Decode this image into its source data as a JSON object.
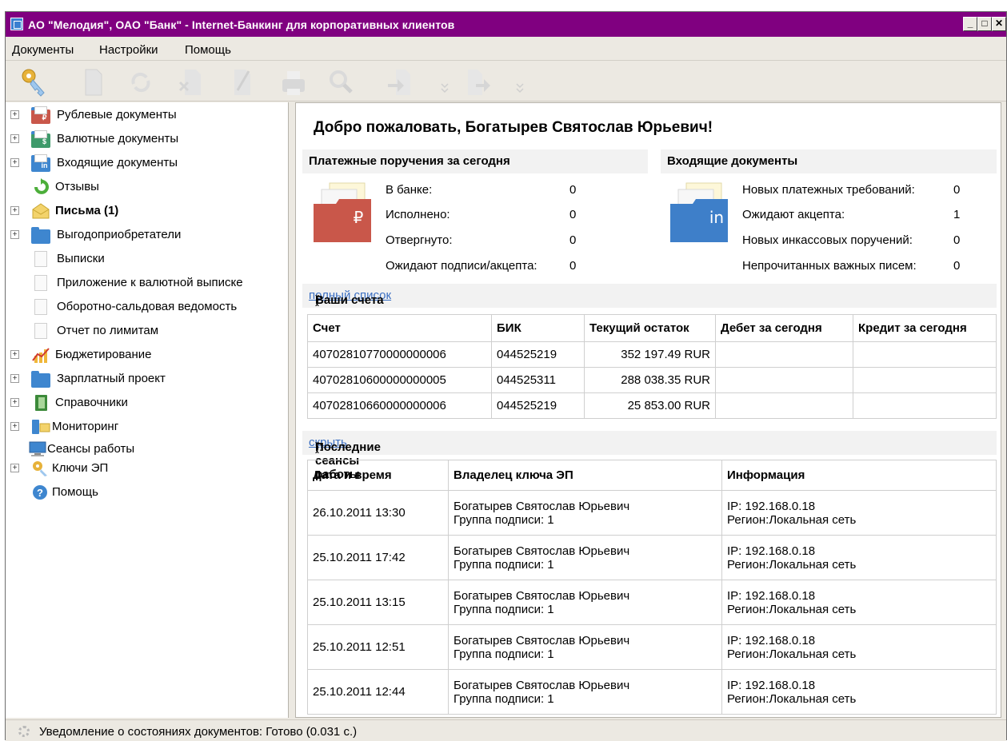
{
  "window": {
    "title": "АО \"Мелодия\", ОАО \"Банк\" - Internet-Банкинг для корпоративных клиентов"
  },
  "menu": [
    "Документы",
    "Настройки",
    "Помощь"
  ],
  "sidebar": {
    "items": [
      {
        "label": "Рублевые документы",
        "icon": "ruble-folder-icon",
        "expandable": true,
        "bold": false
      },
      {
        "label": "Валютные документы",
        "icon": "currency-folder-icon",
        "expandable": true,
        "bold": false
      },
      {
        "label": "Входящие документы",
        "icon": "incoming-folder-icon",
        "expandable": true,
        "bold": false
      },
      {
        "label": "Отзывы",
        "icon": "revoke-icon",
        "expandable": false,
        "bold": false
      },
      {
        "label": "Письма (1)",
        "icon": "envelope-icon",
        "expandable": true,
        "bold": true
      },
      {
        "label": "Выгодоприобретатели",
        "icon": "folder-icon",
        "expandable": true,
        "bold": false
      },
      {
        "label": "Выписки",
        "icon": "document-icon",
        "expandable": false,
        "bold": false
      },
      {
        "label": "Приложение к валютной выписке",
        "icon": "document-icon",
        "expandable": false,
        "bold": false
      },
      {
        "label": "Оборотно-сальдовая ведомость",
        "icon": "document-icon",
        "expandable": false,
        "bold": false
      },
      {
        "label": "Отчет по лимитам",
        "icon": "document-icon",
        "expandable": false,
        "bold": false
      },
      {
        "label": "Бюджетирование",
        "icon": "chart-icon",
        "expandable": true,
        "bold": false
      },
      {
        "label": "Зарплатный проект",
        "icon": "folder-icon",
        "expandable": true,
        "bold": false
      },
      {
        "label": "Справочники",
        "icon": "book-icon",
        "expandable": true,
        "bold": false
      },
      {
        "label": "Мониторинг",
        "icon": "monitoring-icon",
        "expandable": true,
        "bold": false
      },
      {
        "label": "Сеансы работы",
        "icon": "computer-icon",
        "expandable": false,
        "bold": false
      },
      {
        "label": "Ключи ЭП",
        "icon": "key-icon",
        "expandable": true,
        "bold": false
      },
      {
        "label": "Помощь",
        "icon": "help-icon",
        "expandable": false,
        "bold": false
      }
    ]
  },
  "main": {
    "welcome": "Добро пожаловать, Богатырев Святослав Юрьевич!",
    "payments": {
      "title": "Платежные поручения за сегодня",
      "rows": [
        {
          "label": "В банке:",
          "value": "0"
        },
        {
          "label": "Исполнено:",
          "value": "0"
        },
        {
          "label": "Отвергнуто:",
          "value": "0"
        },
        {
          "label": "Ожидают подписи/акцепта:",
          "value": "0"
        }
      ],
      "badge": "₽"
    },
    "incoming": {
      "title": "Входящие документы",
      "rows": [
        {
          "label": "Новых платежных требований:",
          "value": "0"
        },
        {
          "label": "Ожидают акцепта:",
          "value": "1"
        },
        {
          "label": "Новых инкассовых поручений:",
          "value": "0"
        },
        {
          "label": "Непрочитанных важных писем:",
          "value": "0"
        }
      ],
      "badge": "in"
    },
    "accounts": {
      "title": "Ваши счета",
      "link": "полный список",
      "tail": "):",
      "open": " (",
      "columns": [
        "Счет",
        "БИК",
        "Текущий остаток",
        "Дебет за сегодня",
        "Кредит за сегодня"
      ],
      "rows": [
        [
          "40702810770000000006",
          "044525219",
          "352 197.49 RUR",
          "",
          ""
        ],
        [
          "40702810600000000005",
          "044525311",
          "288 038.35 RUR",
          "",
          ""
        ],
        [
          "40702810660000000006",
          "044525219",
          "25 853.00 RUR",
          "",
          ""
        ]
      ]
    },
    "sessions": {
      "title": "Последние сеансы работы",
      "link": "скрыть",
      "tail": "):",
      "open": " (",
      "columns": [
        "Дата и время",
        "Владелец ключа ЭП",
        "Информация"
      ],
      "rows": [
        {
          "date": "26.10.2011 13:30",
          "owner": "Богатырев Святослав Юрьевич",
          "group": "Группа подписи: 1",
          "ip": "IP: 192.168.0.18",
          "region": "Регион:Локальная сеть"
        },
        {
          "date": "25.10.2011 17:42",
          "owner": "Богатырев Святослав Юрьевич",
          "group": "Группа подписи: 1",
          "ip": "IP: 192.168.0.18",
          "region": "Регион:Локальная сеть"
        },
        {
          "date": "25.10.2011 13:15",
          "owner": "Богатырев Святослав Юрьевич",
          "group": "Группа подписи: 1",
          "ip": "IP: 192.168.0.18",
          "region": "Регион:Локальная сеть"
        },
        {
          "date": "25.10.2011 12:51",
          "owner": "Богатырев Святослав Юрьевич",
          "group": "Группа подписи: 1",
          "ip": "IP: 192.168.0.18",
          "region": "Регион:Локальная сеть"
        },
        {
          "date": "25.10.2011 12:44",
          "owner": "Богатырев Святослав Юрьевич",
          "group": "Группа подписи: 1",
          "ip": "IP: 192.168.0.18",
          "region": "Регион:Локальная сеть"
        }
      ]
    }
  },
  "status": {
    "text": "Уведомление о состояниях документов: Готово (0.031 с.)"
  },
  "colors": {
    "titlebar": "#800080",
    "link": "#3b6fc2",
    "ruble_badge": "#c9574a",
    "in_badge": "#3e7fc9"
  }
}
